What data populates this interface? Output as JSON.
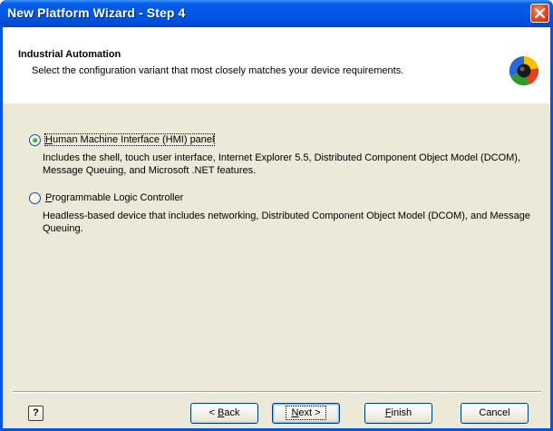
{
  "window": {
    "title": "New Platform Wizard - Step 4"
  },
  "header": {
    "title": "Industrial Automation",
    "subtitle": "Select the configuration variant that most closely matches your device requirements."
  },
  "options": [
    {
      "label_underline": "H",
      "label_rest": "uman Machine Interface (HMI) panel",
      "selected": true,
      "description": "Includes the shell, touch user interface, Internet Explorer 5.5, Distributed Component Object Model (DCOM), Message Queuing, and Microsoft .NET features."
    },
    {
      "label_underline": "P",
      "label_rest": "rogrammable Logic Controller",
      "selected": false,
      "description": "Headless-based device that includes networking, Distributed Component Object Model (DCOM), and Message Queuing."
    }
  ],
  "buttons": {
    "help_label": "?",
    "back_prefix": "< ",
    "back_underline": "B",
    "back_rest": "ack",
    "next_underline": "N",
    "next_rest": "ext >",
    "finish_underline": "F",
    "finish_rest": "inish",
    "cancel_label": "Cancel"
  },
  "colors": {
    "titlebar": "#0055e5",
    "dialog_bg": "#ece9d8",
    "close_button": "#e0451f"
  },
  "icons": {
    "header": "wizard-logo-icon",
    "close": "close-icon",
    "help": "help-icon"
  }
}
